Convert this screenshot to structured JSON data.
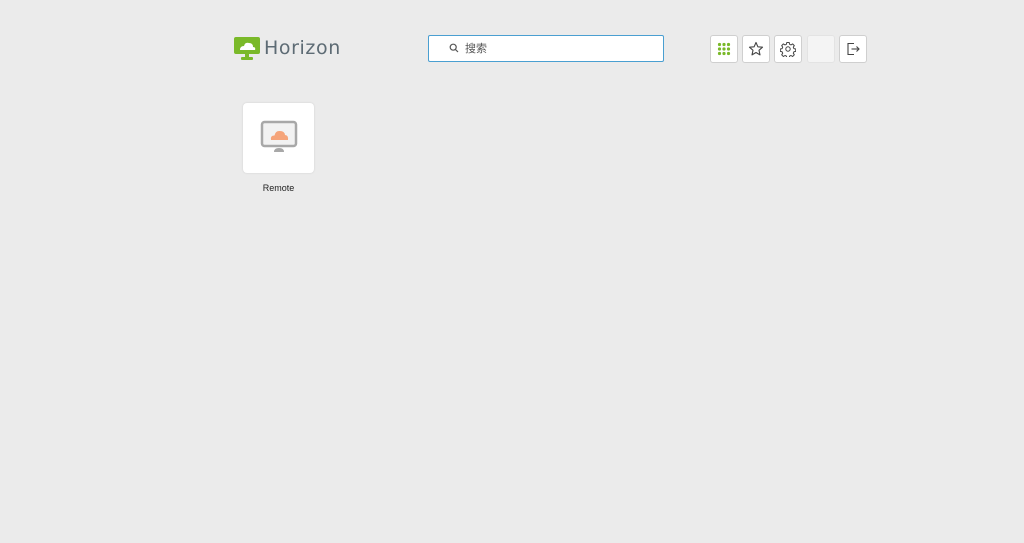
{
  "header": {
    "logo_text": "Horizon",
    "search": {
      "placeholder": "搜索",
      "value": ""
    },
    "toolbar": {
      "apps_icon": "grid-icon",
      "favorites_icon": "star-icon",
      "settings_icon": "gear-icon",
      "logout_icon": "logout-icon"
    }
  },
  "apps": [
    {
      "label": "Remote",
      "icon": "desktop-cloud-icon"
    }
  ],
  "colors": {
    "brand_green": "#7ab929",
    "search_border": "#4a9fd1",
    "background": "#ebebeb",
    "cloud_orange": "#f5a47a"
  }
}
